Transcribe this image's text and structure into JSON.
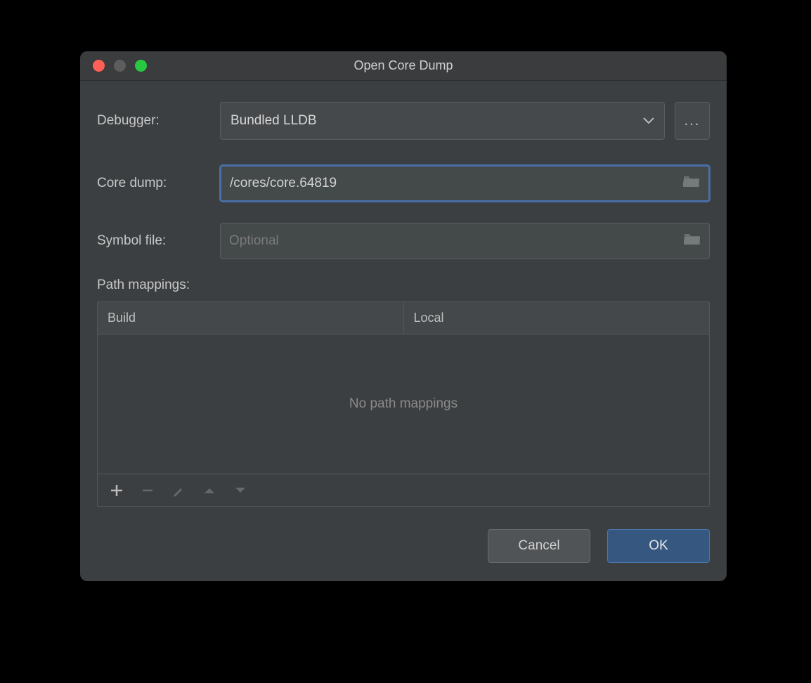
{
  "title": "Open Core Dump",
  "fields": {
    "debugger_label": "Debugger:",
    "debugger_value": "Bundled LLDB",
    "core_dump_label": "Core dump:",
    "core_dump_value": "/cores/core.64819",
    "symbol_file_label": "Symbol file:",
    "symbol_file_value": "",
    "symbol_file_placeholder": "Optional"
  },
  "path_mappings": {
    "label": "Path mappings:",
    "columns": {
      "build": "Build",
      "local": "Local"
    },
    "empty_text": "No path mappings"
  },
  "buttons": {
    "cancel": "Cancel",
    "ok": "OK"
  }
}
